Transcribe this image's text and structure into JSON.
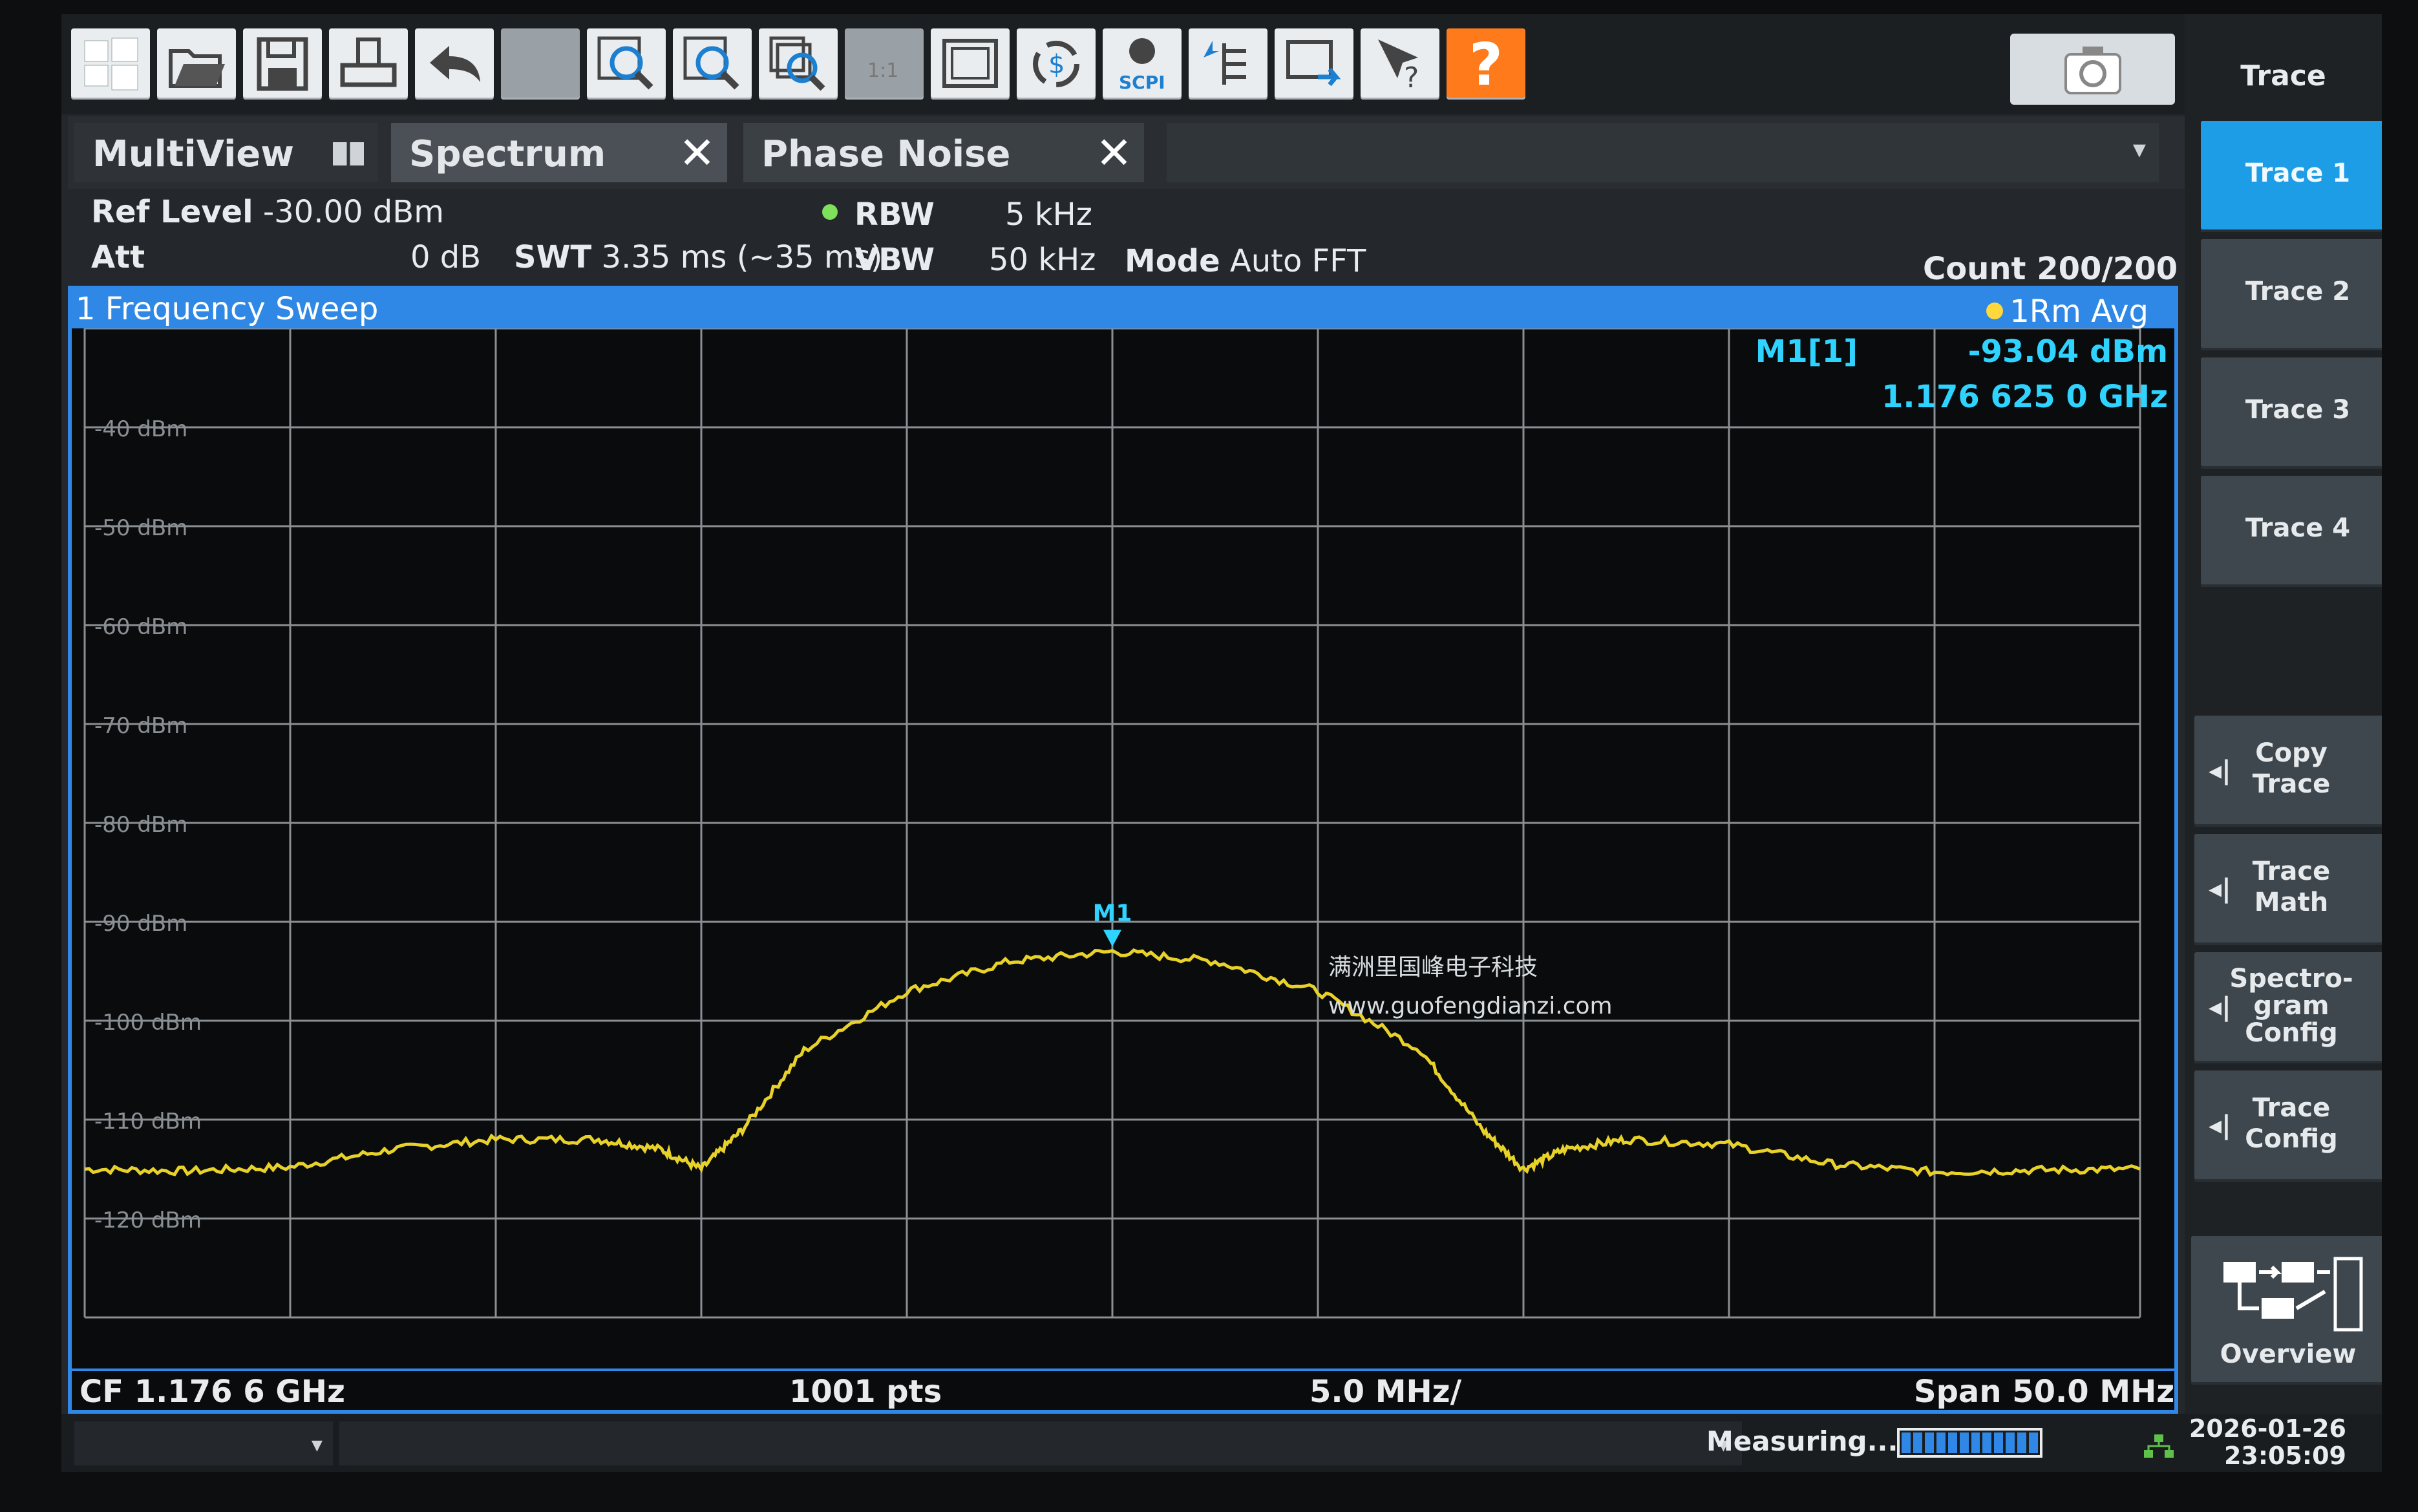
{
  "toolbar": {
    "icons": [
      "windows-start-icon",
      "folder-open-icon",
      "save-icon",
      "print-icon",
      "undo-icon",
      "redo-icon",
      "zoom-icon",
      "multi-zoom-icon",
      "zoom-mode-icon",
      "zoom-off-icon",
      "full-screen-icon",
      "refresh-icon",
      "scpi-icon",
      "sequencer-icon",
      "display-icon",
      "help-pointer-icon",
      "help-icon"
    ],
    "scpi_label": "SCPI",
    "help_label": "?"
  },
  "tabs": {
    "multiview": "MultiView",
    "spectrum": "Spectrum",
    "phase_noise": "Phase Noise",
    "close_glyph": "✕",
    "overflow_glyph": "▾"
  },
  "params": {
    "ref_level_label": "Ref Level",
    "ref_level_value": "-30.00 dBm",
    "att_label": "Att",
    "att_value": "0 dB",
    "swt_label": "SWT",
    "swt_value": "3.35 ms (~35 ms)",
    "rbw_label": "RBW",
    "rbw_value": "5 kHz",
    "vbw_label": "VBW",
    "vbw_value": "50 kHz",
    "mode_label": "Mode",
    "mode_value": "Auto FFT",
    "count": "Count 200/200"
  },
  "window": {
    "title": "1 Frequency Sweep",
    "trace_mode": "1Rm Avg",
    "marker_name": "M1[1]",
    "marker_level": "-93.04 dBm",
    "marker_freq": "1.176 625 0 GHz",
    "marker_label": "M1",
    "footer_cf": "CF 1.176 6 GHz",
    "footer_pts": "1001 pts",
    "footer_div": "5.0 MHz/",
    "footer_span": "Span 50.0 MHz"
  },
  "chart_data": {
    "type": "line",
    "title": "1 Frequency Sweep",
    "center_freq_ghz": 1.1766,
    "span_mhz": 50.0,
    "x_unit": "MHz offset from CF",
    "ylim": [
      -130,
      -30
    ],
    "y_ticks": [
      "-40 dBm",
      "-50 dBm",
      "-60 dBm",
      "-70 dBm",
      "-80 dBm",
      "-90 dBm",
      "-100 dBm",
      "-110 dBm",
      "-120 dBm"
    ],
    "y_tick_values": [
      -40,
      -50,
      -60,
      -70,
      -80,
      -90,
      -100,
      -110,
      -120
    ],
    "grid": true,
    "series": [
      {
        "name": "1Rm Avg",
        "color": "#e8d229",
        "x": [
          -25,
          -22.5,
          -20,
          -17.5,
          -15,
          -12.5,
          -11,
          -10,
          -9,
          -7.5,
          -5,
          -2.5,
          0,
          2.5,
          5,
          7.5,
          9,
          10,
          11,
          12.5,
          15,
          17.5,
          20,
          22.5,
          25
        ],
        "y": [
          -115,
          -115.2,
          -114.8,
          -113,
          -112,
          -112,
          -113,
          -115,
          -111,
          -103,
          -97,
          -94,
          -93,
          -94,
          -97,
          -103,
          -111,
          -115,
          -113,
          -112,
          -112.5,
          -114.5,
          -115.3,
          -115.1,
          -115
        ]
      }
    ],
    "marker": {
      "name": "M1",
      "x": 0,
      "y": -93.04
    }
  },
  "watermark": {
    "line1": "满洲里国峰电子科技",
    "line2": "www.guofengdianzi.com"
  },
  "panel": {
    "title": "Trace",
    "buttons": [
      "Trace 1",
      "Trace 2",
      "Trace 3",
      "Trace 4"
    ],
    "actions": [
      {
        "label": "Copy\nTrace"
      },
      {
        "label": "Trace\nMath"
      },
      {
        "label": "Spectro-\ngram\nConfig"
      },
      {
        "label": "Trace\nConfig"
      }
    ],
    "overview": "Overview",
    "arrow_glyph": "◂|"
  },
  "status": {
    "measuring": "Measuring...",
    "progress": 1.0,
    "date": "2026-01-26",
    "time": "23:05:09",
    "combo_glyph": "▾"
  },
  "colors": {
    "accent": "#2f88e6",
    "trace": "#e8d229",
    "marker": "#2fd3ff",
    "active_softkey": "#1d9de6",
    "help": "#ff7a1a"
  }
}
